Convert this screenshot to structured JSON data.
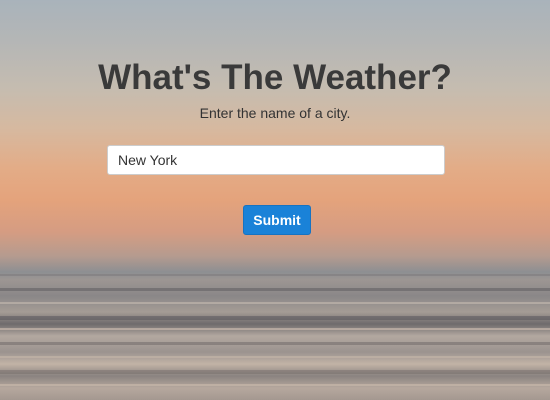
{
  "page": {
    "title": "What's The Weather?",
    "subtitle": "Enter the name of a city."
  },
  "form": {
    "city_value": "New York",
    "submit_label": "Submit"
  },
  "colors": {
    "button_bg": "#1a82d8",
    "title_text": "#3a3a3a"
  }
}
